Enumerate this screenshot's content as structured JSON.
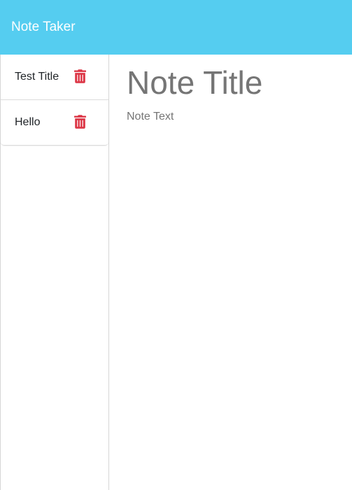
{
  "navbar": {
    "brand": "Note Taker",
    "background": "#55cdf0"
  },
  "sidebar": {
    "notes": [
      {
        "title": "Test Title",
        "delete_icon": "trash-icon"
      },
      {
        "title": "Hello",
        "delete_icon": "trash-icon"
      }
    ],
    "delete_color": "#dc3545"
  },
  "editor": {
    "title_placeholder": "Note Title",
    "text_placeholder": "Note Text"
  }
}
